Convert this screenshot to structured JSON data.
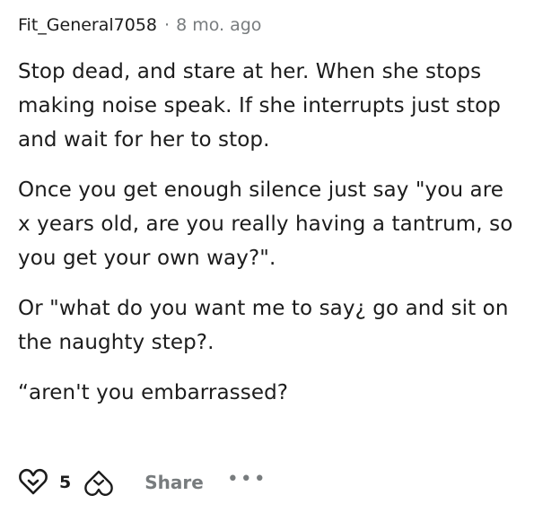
{
  "comment": {
    "author": "Fit_General7058",
    "separator": "·",
    "age": "8 mo. ago",
    "paragraphs": [
      "Stop dead, and stare at her. When she stops making noise speak. If she interrupts just stop and wait for her to stop.",
      "Once you get enough silence just say \"you are x years old, are you really having a tantrum, so you get your own way?\".",
      "Or \"what do you want me to say¿ go and sit on the naughty step?.",
      "“aren't you embarrassed?"
    ]
  },
  "actions": {
    "upvote_icon": "upvote-icon",
    "vote_count": "5",
    "downvote_icon": "downvote-icon",
    "share_label": "Share",
    "more_label": "•••"
  },
  "colors": {
    "text": "#1c1c1c",
    "muted": "#787c7e",
    "upvote_fill": "#ffffff",
    "background": "#ffffff"
  }
}
